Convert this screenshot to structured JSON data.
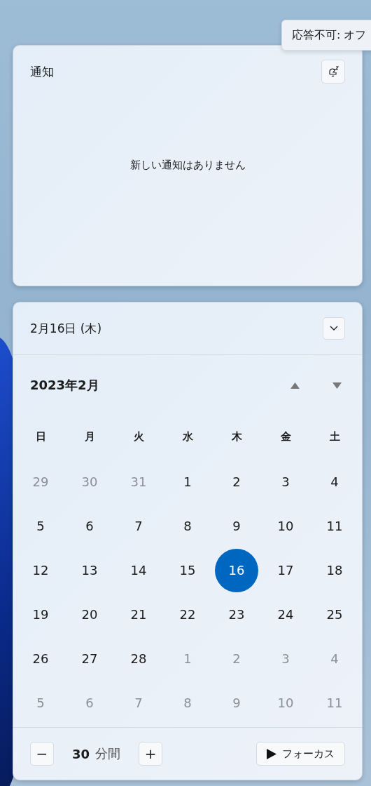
{
  "tooltip": {
    "text": "応答不可: オフ"
  },
  "notifications": {
    "title": "通知",
    "empty_message": "新しい通知はありません"
  },
  "calendar": {
    "date": "2月16日 (木)",
    "month": "2023年2月",
    "weekdays": [
      "日",
      "月",
      "火",
      "水",
      "木",
      "金",
      "土"
    ],
    "days": [
      {
        "day": "29",
        "muted": true,
        "selected": false
      },
      {
        "day": "30",
        "muted": true,
        "selected": false
      },
      {
        "day": "31",
        "muted": true,
        "selected": false
      },
      {
        "day": "1",
        "muted": false,
        "selected": false
      },
      {
        "day": "2",
        "muted": false,
        "selected": false
      },
      {
        "day": "3",
        "muted": false,
        "selected": false
      },
      {
        "day": "4",
        "muted": false,
        "selected": false
      },
      {
        "day": "5",
        "muted": false,
        "selected": false
      },
      {
        "day": "6",
        "muted": false,
        "selected": false
      },
      {
        "day": "7",
        "muted": false,
        "selected": false
      },
      {
        "day": "8",
        "muted": false,
        "selected": false
      },
      {
        "day": "9",
        "muted": false,
        "selected": false
      },
      {
        "day": "10",
        "muted": false,
        "selected": false
      },
      {
        "day": "11",
        "muted": false,
        "selected": false
      },
      {
        "day": "12",
        "muted": false,
        "selected": false
      },
      {
        "day": "13",
        "muted": false,
        "selected": false
      },
      {
        "day": "14",
        "muted": false,
        "selected": false
      },
      {
        "day": "15",
        "muted": false,
        "selected": false
      },
      {
        "day": "16",
        "muted": false,
        "selected": true
      },
      {
        "day": "17",
        "muted": false,
        "selected": false
      },
      {
        "day": "18",
        "muted": false,
        "selected": false
      },
      {
        "day": "19",
        "muted": false,
        "selected": false
      },
      {
        "day": "20",
        "muted": false,
        "selected": false
      },
      {
        "day": "21",
        "muted": false,
        "selected": false
      },
      {
        "day": "22",
        "muted": false,
        "selected": false
      },
      {
        "day": "23",
        "muted": false,
        "selected": false
      },
      {
        "day": "24",
        "muted": false,
        "selected": false
      },
      {
        "day": "25",
        "muted": false,
        "selected": false
      },
      {
        "day": "26",
        "muted": false,
        "selected": false
      },
      {
        "day": "27",
        "muted": false,
        "selected": false
      },
      {
        "day": "28",
        "muted": false,
        "selected": false
      },
      {
        "day": "1",
        "muted": true,
        "selected": false
      },
      {
        "day": "2",
        "muted": true,
        "selected": false
      },
      {
        "day": "3",
        "muted": true,
        "selected": false
      },
      {
        "day": "4",
        "muted": true,
        "selected": false
      },
      {
        "day": "5",
        "muted": true,
        "selected": false
      },
      {
        "day": "6",
        "muted": true,
        "selected": false
      },
      {
        "day": "7",
        "muted": true,
        "selected": false
      },
      {
        "day": "8",
        "muted": true,
        "selected": false
      },
      {
        "day": "9",
        "muted": true,
        "selected": false
      },
      {
        "day": "10",
        "muted": true,
        "selected": false
      },
      {
        "day": "11",
        "muted": true,
        "selected": false
      }
    ]
  },
  "focus": {
    "decrease": "−",
    "minutes": "30",
    "unit": "分間",
    "increase": "+",
    "start_label": "フォーカス"
  }
}
